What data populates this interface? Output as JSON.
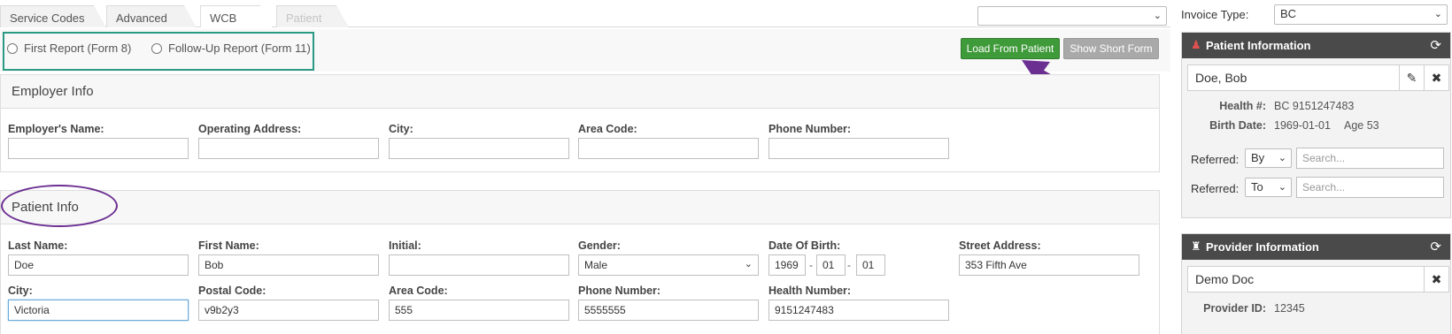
{
  "tabs": [
    {
      "label": "Service Codes",
      "state": "inactive"
    },
    {
      "label": "Advanced",
      "state": "inactive"
    },
    {
      "label": "WCB",
      "state": "active"
    },
    {
      "label": "Patient",
      "state": "disabled"
    }
  ],
  "top_select": {
    "value": ""
  },
  "report_options": [
    {
      "label": "First Report (Form 8)",
      "checked": false
    },
    {
      "label": "Follow-Up Report (Form 11)",
      "checked": false
    }
  ],
  "actions": {
    "load_from_patient": "Load From Patient",
    "show_short_form": "Show Short Form"
  },
  "employer": {
    "title": "Employer Info",
    "fields": [
      {
        "label": "Employer's Name:",
        "value": ""
      },
      {
        "label": "Operating Address:",
        "value": ""
      },
      {
        "label": "City:",
        "value": ""
      },
      {
        "label": "Area Code:",
        "value": ""
      },
      {
        "label": "Phone Number:",
        "value": ""
      }
    ]
  },
  "patient": {
    "title": "Patient Info",
    "last_name": {
      "label": "Last Name:",
      "value": "Doe"
    },
    "first_name": {
      "label": "First Name:",
      "value": "Bob"
    },
    "initial": {
      "label": "Initial:",
      "value": ""
    },
    "gender": {
      "label": "Gender:",
      "value": "Male"
    },
    "dob": {
      "label": "Date Of Birth:",
      "year": "1969",
      "month": "01",
      "day": "01",
      "sep": "-"
    },
    "street": {
      "label": "Street Address:",
      "value": "353 Fifth Ave"
    },
    "city": {
      "label": "City:",
      "value": "Victoria"
    },
    "postal": {
      "label": "Postal Code:",
      "value": "v9b2y3"
    },
    "area_code": {
      "label": "Area Code:",
      "value": "555"
    },
    "phone": {
      "label": "Phone Number:",
      "value": "5555555"
    },
    "health_number": {
      "label": "Health Number:",
      "value": "9151247483"
    }
  },
  "invoice": {
    "label": "Invoice Type:",
    "value": "BC"
  },
  "patient_card": {
    "title": "Patient Information",
    "name": "Doe, Bob",
    "health_label": "Health #:",
    "health_value": "BC  9151247483",
    "birth_label": "Birth Date:",
    "birth_value": "1969-01-01",
    "age": "Age 53",
    "referred_by": {
      "label": "Referred:",
      "value": "By",
      "placeholder": "Search..."
    },
    "referred_to": {
      "label": "Referred:",
      "value": "To",
      "placeholder": "Search..."
    }
  },
  "provider_card": {
    "title": "Provider Information",
    "name": "Demo Doc",
    "id_label": "Provider ID:",
    "id_value": "12345"
  },
  "colors": {
    "highlight_box": "#2a9a84",
    "annotation_purple": "#6b2e91",
    "button_green": "#3f9a3a",
    "card_header": "#4a4a4a"
  }
}
